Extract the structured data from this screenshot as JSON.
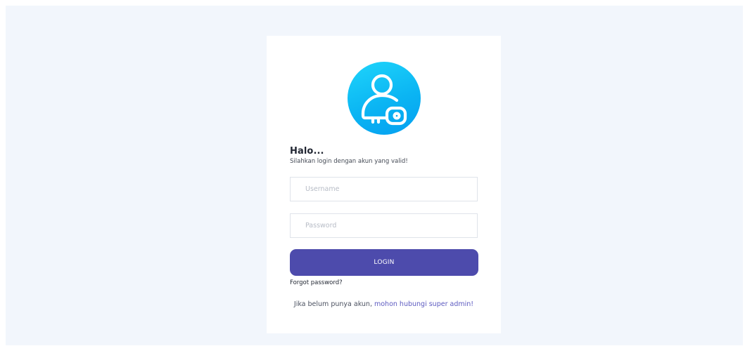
{
  "login": {
    "greeting": "Halo...",
    "subtitle": "Silahkan login dengan akun yang valid!",
    "username_placeholder": "Username",
    "password_placeholder": "Password",
    "login_label": "LOGIN",
    "forgot_label": "Forgot password?",
    "footer_text": "Jika belum punya akun, ",
    "footer_link": "mohon hubungi super admin!"
  },
  "icons": {
    "logo": "user-key-icon"
  },
  "colors": {
    "page_background": "#f2f6fc",
    "card_background": "#ffffff",
    "logo_gradient_start": "#1fd5fb",
    "logo_gradient_end": "#059ff0",
    "button": "#4d4bac",
    "link": "#5c5ac0"
  }
}
